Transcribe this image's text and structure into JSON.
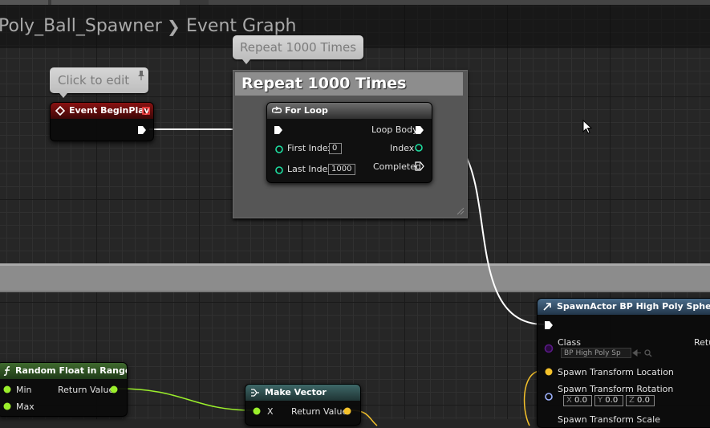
{
  "breadcrumb": {
    "blueprint": "Poly_Ball_Spawner",
    "separator": "❯",
    "graph": "Event Graph"
  },
  "comment": {
    "bubble_label": "Repeat 1000 Times",
    "title": "Repeat 1000 Times"
  },
  "edit_bubble": {
    "label": "Click to edit"
  },
  "nodes": {
    "begin_play": {
      "title": "Event BeginPlay"
    },
    "for_loop": {
      "title": "For Loop",
      "first_index_label": "First Index",
      "first_index_value": "0",
      "last_index_label": "Last Index",
      "last_index_value": "1000",
      "loop_body_label": "Loop Body",
      "index_label": "Index",
      "completed_label": "Completed"
    },
    "spawn_actor": {
      "title": "SpawnActor BP High Poly Sphere",
      "class_label": "Class",
      "class_value": "BP High Poly Sp",
      "return_label": "Retu",
      "location_label": "Spawn Transform Location",
      "rotation_label": "Spawn Transform Rotation",
      "rot_x_label": "X",
      "rot_x_value": "0.0",
      "rot_y_label": "Y",
      "rot_y_value": "0.0",
      "rot_z_label": "Z",
      "rot_z_value": "0.0",
      "scale_label": "Spawn Transform Scale"
    },
    "random_float": {
      "title": "Random Float in Range",
      "min_label": "Min",
      "max_label": "Max",
      "return_label": "Return Value"
    },
    "make_vector": {
      "title": "Make Vector",
      "x_label": "X",
      "return_label": "Return Value"
    }
  },
  "colors": {
    "exec": "#ffffff",
    "float": "#9bef2b",
    "int": "#1edfa1",
    "vector": "#f5c22b",
    "rotator": "#9fb3ff",
    "class": "#5a1a86",
    "event_header": "#8a1212"
  }
}
